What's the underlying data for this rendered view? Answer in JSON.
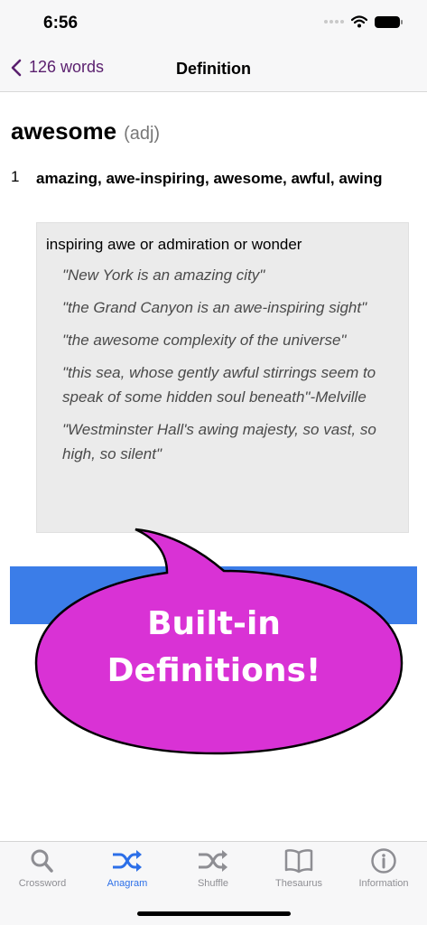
{
  "status_bar": {
    "time": "6:56"
  },
  "nav": {
    "back_label": "126 words",
    "title": "Definition"
  },
  "entry": {
    "word": "awesome",
    "part_of_speech": "(adj)",
    "sense_number": "1",
    "synonyms": "amazing, awe-inspiring, awesome, awful, awing",
    "gloss": "inspiring awe or admiration or wonder",
    "examples": [
      "\"New York is an amazing city\"",
      "\"the Grand Canyon is an awe-inspiring sight\"",
      "\"the awesome complexity of the universe\"",
      "\"this sea, whose gently awful stirrings seem to speak of some hidden soul beneath\"-Melville",
      "\"Westminster Hall's awing majesty, so vast, so high, so silent\""
    ]
  },
  "promo": {
    "line1": "Built-in",
    "line2": "Definitions!",
    "bubble_color": "#d932d5",
    "band_color": "#3b7de8"
  },
  "tabs": [
    {
      "label": "Crossword",
      "icon": "search-icon",
      "active": false
    },
    {
      "label": "Anagram",
      "icon": "shuffle-icon",
      "active": true
    },
    {
      "label": "Shuffle",
      "icon": "shuffle-icon",
      "active": false
    },
    {
      "label": "Thesaurus",
      "icon": "book-icon",
      "active": false
    },
    {
      "label": "Information",
      "icon": "info-icon",
      "active": false
    }
  ],
  "colors": {
    "accent": "#5a1f6e",
    "tab_active": "#2c6fe8",
    "tab_inactive": "#8e8e93"
  }
}
